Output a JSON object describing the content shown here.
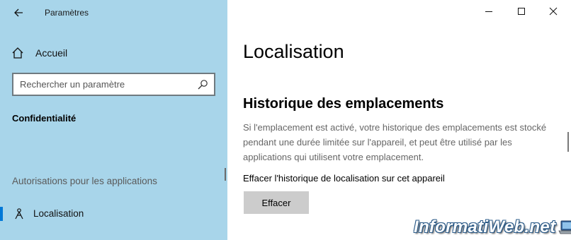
{
  "window": {
    "title": "Paramètres",
    "controls": {
      "minimize_icon": "minimize-icon",
      "maximize_icon": "maximize-icon",
      "close_icon": "close-icon"
    }
  },
  "sidebar": {
    "back_icon": "back-arrow-icon",
    "home": {
      "label": "Accueil",
      "icon": "home-icon"
    },
    "search": {
      "placeholder": "Rechercher un paramètre",
      "icon": "search-icon"
    },
    "section_title": "Confidentialité",
    "group_header": "Autorisations pour les applications",
    "items": [
      {
        "label": "Localisation",
        "icon": "location-icon",
        "selected": true
      }
    ]
  },
  "main": {
    "title": "Localisation",
    "history": {
      "heading": "Historique des emplacements",
      "description": "Si l'emplacement est activé, votre historique des emplacements est stocké pendant une durée limitée sur l'appareil, et peut être utilisé par les applications qui utilisent votre emplacement.",
      "clear_label": "Effacer l'historique de localisation sur cet appareil",
      "clear_button": "Effacer"
    }
  },
  "watermark": {
    "text": "InformatiWeb.net"
  },
  "colors": {
    "sidebar_bg": "#a8d5ea",
    "accent": "#0078d7",
    "button_bg": "#cccccc",
    "description_text": "#666666"
  }
}
